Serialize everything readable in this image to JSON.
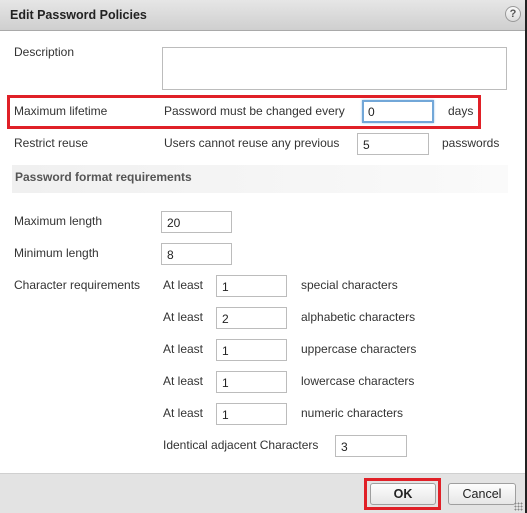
{
  "dialog": {
    "title": "Edit Password Policies",
    "help_icon": "?"
  },
  "description": {
    "label": "Description",
    "value": ""
  },
  "max_lifetime": {
    "label": "Maximum lifetime",
    "prefix": "Password must be changed every",
    "value": "0",
    "suffix": "days"
  },
  "restrict_reuse": {
    "label": "Restrict reuse",
    "prefix": "Users cannot reuse any previous",
    "value": "5",
    "suffix": "passwords"
  },
  "format_section": {
    "title": "Password format requirements"
  },
  "max_length": {
    "label": "Maximum length",
    "value": "20"
  },
  "min_length": {
    "label": "Minimum length",
    "value": "8"
  },
  "char_requirements": {
    "label": "Character requirements",
    "rows": [
      {
        "prefix": "At least",
        "value": "1",
        "suffix": "special characters"
      },
      {
        "prefix": "At least",
        "value": "2",
        "suffix": "alphabetic characters"
      },
      {
        "prefix": "At least",
        "value": "1",
        "suffix": "uppercase characters"
      },
      {
        "prefix": "At least",
        "value": "1",
        "suffix": "lowercase characters"
      },
      {
        "prefix": "At least",
        "value": "1",
        "suffix": "numeric characters"
      }
    ],
    "identical_adjacent": {
      "label": "Identical adjacent Characters",
      "value": "3"
    }
  },
  "footer": {
    "ok_label": "OK",
    "cancel_label": "Cancel"
  },
  "highlight_color": "#e02027"
}
